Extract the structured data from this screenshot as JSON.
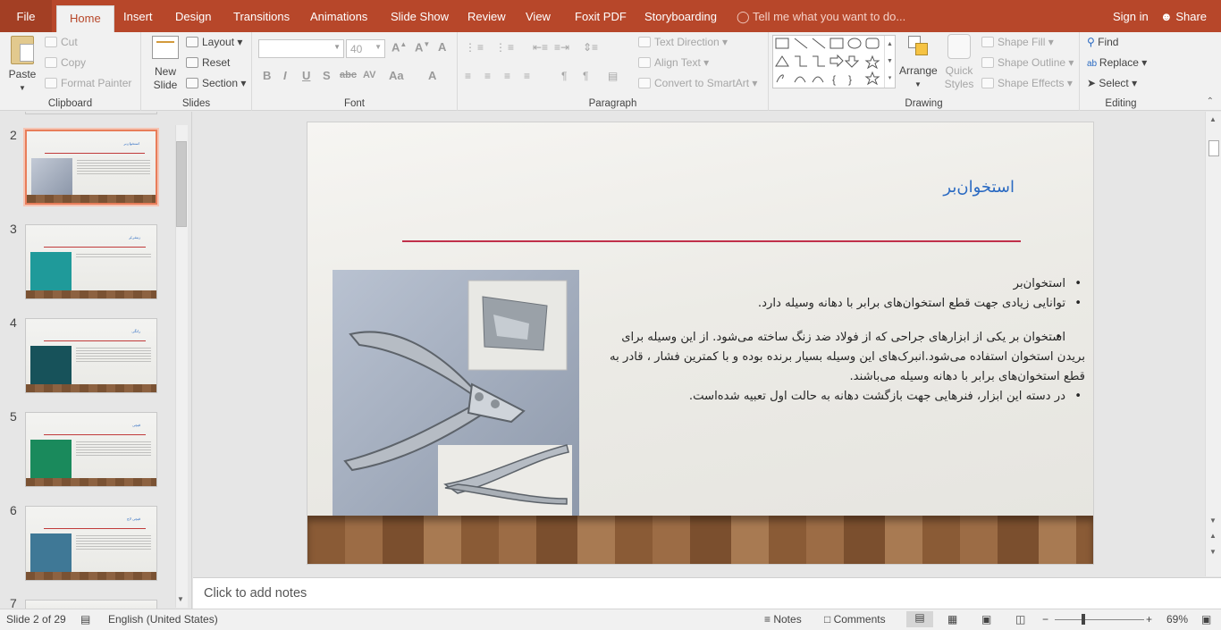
{
  "tabs": {
    "file": "File",
    "items": [
      "Home",
      "Insert",
      "Design",
      "Transitions",
      "Animations",
      "Slide Show",
      "Review",
      "View",
      "Foxit PDF",
      "Storyboarding"
    ],
    "active": "Home",
    "tell_me": "Tell me what you want to do...",
    "sign_in": "Sign in",
    "share": "Share"
  },
  "ribbon": {
    "clipboard": {
      "label": "Clipboard",
      "paste": "Paste",
      "cut": "Cut",
      "copy": "Copy",
      "format_painter": "Format Painter"
    },
    "slides": {
      "label": "Slides",
      "new_slide_1": "New",
      "new_slide_2": "Slide",
      "layout": "Layout",
      "reset": "Reset",
      "section": "Section"
    },
    "font": {
      "label": "Font",
      "font_name": "",
      "font_size": "40"
    },
    "paragraph": {
      "label": "Paragraph",
      "text_direction": "Text Direction",
      "align_text": "Align Text",
      "convert_smartart": "Convert to SmartArt"
    },
    "drawing": {
      "label": "Drawing",
      "arrange": "Arrange",
      "quick_styles_1": "Quick",
      "quick_styles_2": "Styles",
      "shape_fill": "Shape Fill",
      "shape_outline": "Shape Outline",
      "shape_effects": "Shape Effects"
    },
    "editing": {
      "label": "Editing",
      "find": "Find",
      "replace": "Replace",
      "select": "Select"
    }
  },
  "thumbnails": [
    {
      "num": "2",
      "title": "استخوان‌بر",
      "selected": true
    },
    {
      "num": "3",
      "title": "زنبقی‌بُر",
      "selected": false
    },
    {
      "num": "4",
      "title": "رانگی",
      "selected": false
    },
    {
      "num": "5",
      "title": "قیچی",
      "selected": false
    },
    {
      "num": "6",
      "title": "قیچی لاچ",
      "selected": false
    },
    {
      "num": "7",
      "title": "",
      "selected": false
    }
  ],
  "slide": {
    "title": "استخوان‌بر",
    "bullets": [
      "استخوان‌بر",
      "توانایی زیادی جهت قطع استخوان‌های برابر با دهانه وسیله دارد."
    ],
    "paragraph": "استخوان بر یکی از ابزارهای جراحی که از فولاد ضد زنگ ساخته می‌شود. از این وسیله برای بریدن استخوان استفاده می‌شود.انبرک‌های این وسیله بسیار برنده بوده و با کمترین فشار ، قادر به قطع استخوان‌های برابر با دهانه وسیله می‌باشند.",
    "last_bullet": "در دسته این ابزار، فنرهایی جهت بازگشت دهانه به حالت اول تعبیه شده‌است."
  },
  "notes_placeholder": "Click to add notes",
  "status": {
    "slide_count": "Slide 2 of 29",
    "language": "English (United States)",
    "notes": "Notes",
    "comments": "Comments",
    "zoom": "69%"
  },
  "colors": {
    "accent": "#b7472a",
    "title_blue": "#2a6ac2",
    "rule_red": "#c0304a"
  }
}
